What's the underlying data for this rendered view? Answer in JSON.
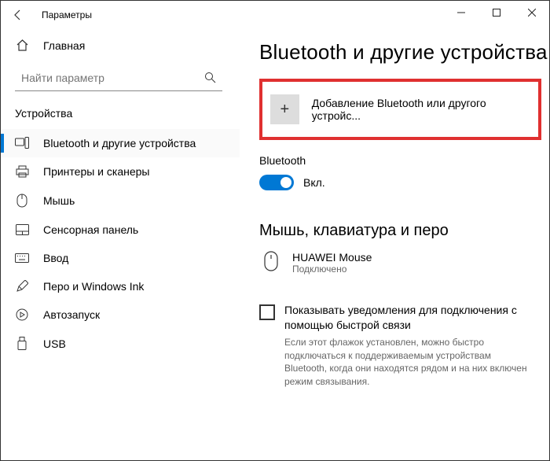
{
  "window": {
    "title": "Параметры"
  },
  "sidebar": {
    "home": "Главная",
    "search_placeholder": "Найти параметр",
    "section": "Устройства",
    "items": [
      {
        "label": "Bluetooth и другие устройства"
      },
      {
        "label": "Принтеры и сканеры"
      },
      {
        "label": "Мышь"
      },
      {
        "label": "Сенсорная панель"
      },
      {
        "label": "Ввод"
      },
      {
        "label": "Перо и Windows Ink"
      },
      {
        "label": "Автозапуск"
      },
      {
        "label": "USB"
      }
    ]
  },
  "main": {
    "heading": "Bluetooth и другие устройства",
    "add_device": "Добавление Bluetooth или другого устройс...",
    "bt_label": "Bluetooth",
    "bt_state": "Вкл.",
    "section2": "Мышь, клавиатура и перо",
    "device": {
      "name": "HUAWEI  Mouse",
      "status": "Подключено"
    },
    "checkbox": {
      "label": "Показывать уведомления для подключения с помощью быстрой связи",
      "desc": "Если этот флажок установлен, можно быстро подключаться к поддерживаемым устройствам Bluetooth, когда они находятся рядом и на них включен режим связывания."
    }
  }
}
